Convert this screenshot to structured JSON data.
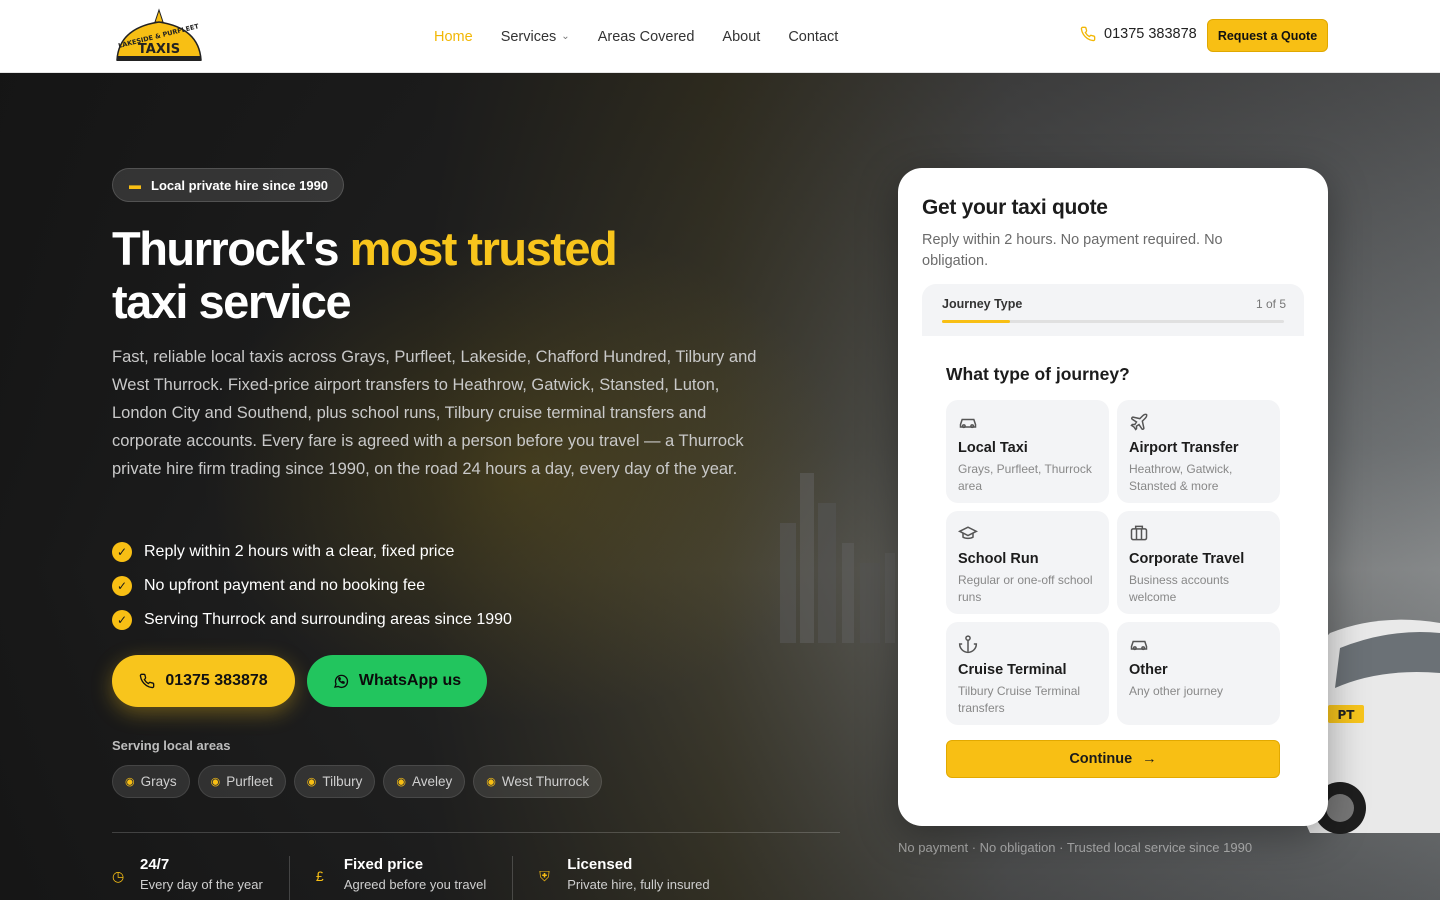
{
  "header": {
    "logo_text_top": "LAKESIDE & PURFLEET",
    "logo_text_bottom": "TAXIS",
    "nav": [
      {
        "label": "Home",
        "active": true
      },
      {
        "label": "Services",
        "dropdown": true
      },
      {
        "label": "Areas Covered"
      },
      {
        "label": "About"
      },
      {
        "label": "Contact"
      }
    ],
    "phone": "01375 383878",
    "quote_button": "Request a Quote"
  },
  "hero": {
    "badge": "Local private hire since 1990",
    "title_part1": "Thurrock's ",
    "title_highlight": "most trusted",
    "title_part2": "taxi service",
    "lead": "Fast, reliable local taxis across Grays, Purfleet, Lakeside, Chafford Hundred, Tilbury and West Thurrock. Fixed-price airport transfers to Heathrow, Gatwick, Stansted, Luton, London City and Southend, plus school runs, Tilbury cruise terminal transfers and corporate accounts. Every fare is agreed with a person before you travel — a Thurrock private hire firm trading since 1990, on the road 24 hours a day, every day of the year.",
    "checks": [
      "Reply within 2 hours with a clear, fixed price",
      "No upfront payment and no booking fee",
      "Serving Thurrock and surrounding areas since 1990"
    ],
    "cta_phone": "01375 383878",
    "cta_whatsapp": "WhatsApp us",
    "areas_title": "Serving local areas",
    "areas": [
      "Grays",
      "Purfleet",
      "Tilbury",
      "Aveley",
      "West Thurrock"
    ],
    "stats": [
      {
        "title": "24/7",
        "sub": "Every day of the year",
        "icon": "clock-icon"
      },
      {
        "title": "Fixed price",
        "sub": "Agreed before you travel",
        "icon": "pound-icon"
      },
      {
        "title": "Licensed",
        "sub": "Private hire, fully insured",
        "icon": "shield-icon"
      }
    ]
  },
  "quote": {
    "title": "Get your taxi quote",
    "subtitle": "Reply within 2 hours. No payment required. No obligation.",
    "progress_label": "Journey Type",
    "progress_step": "1 of 5",
    "progress_fraction": 0.2,
    "question": "What type of journey?",
    "options": [
      {
        "title": "Local Taxi",
        "desc": "Grays, Purfleet, Thurrock area",
        "icon": "car-icon"
      },
      {
        "title": "Airport Transfer",
        "desc": "Heathrow, Gatwick, Stansted & more",
        "icon": "plane-icon"
      },
      {
        "title": "School Run",
        "desc": "Regular or one-off school runs",
        "icon": "graduation-cap-icon"
      },
      {
        "title": "Corporate Travel",
        "desc": "Business accounts welcome",
        "icon": "briefcase-icon"
      },
      {
        "title": "Cruise Terminal",
        "desc": "Tilbury Cruise Terminal transfers",
        "icon": "anchor-icon"
      },
      {
        "title": "Other",
        "desc": "Any other journey",
        "icon": "car-icon"
      }
    ],
    "continue": "Continue",
    "footnote": "No payment · No obligation · Trusted local service since 1990"
  },
  "colors": {
    "accent": "#f8bf14",
    "whatsapp": "#22c55e"
  }
}
